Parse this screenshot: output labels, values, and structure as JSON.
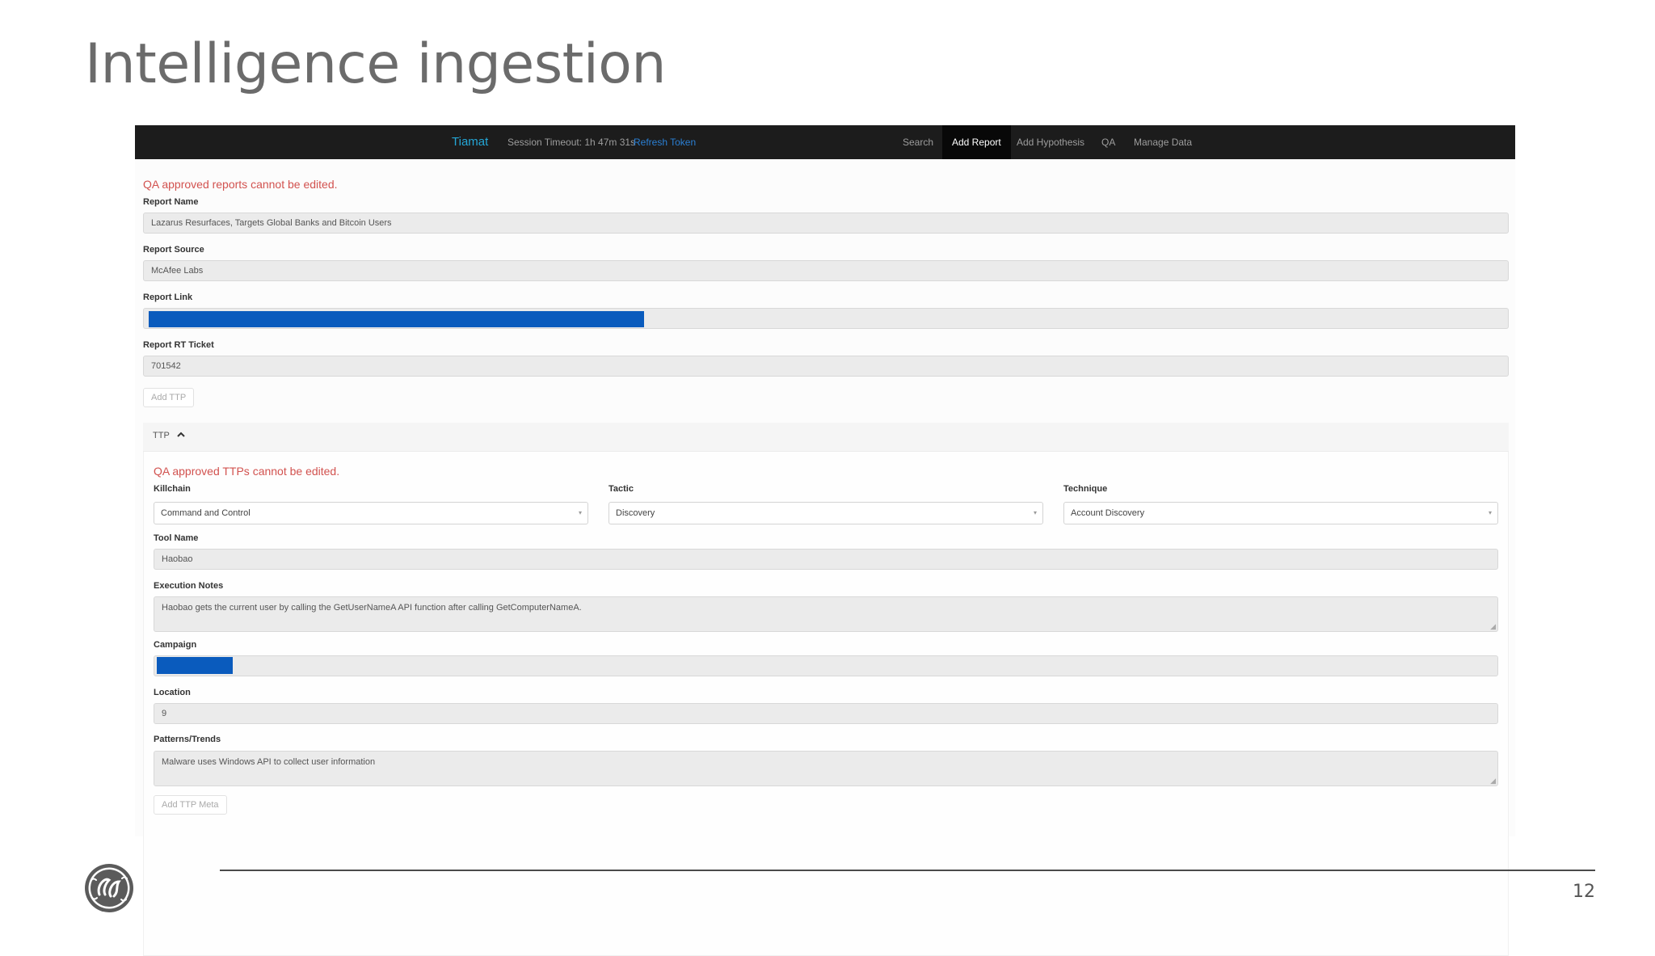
{
  "slide": {
    "title": "Intelligence ingestion",
    "page_number": "12"
  },
  "navbar": {
    "brand": "Tiamat",
    "session_timeout": "Session Timeout: 1h 47m 31s",
    "refresh_token": "Refresh Token",
    "items": [
      {
        "label": "Search"
      },
      {
        "label": "Add Report",
        "active": true
      },
      {
        "label": "Add Hypothesis"
      },
      {
        "label": "QA"
      },
      {
        "label": "Manage Data"
      }
    ]
  },
  "report": {
    "qa_message": "QA approved reports cannot be edited.",
    "name_label": "Report Name",
    "name_value": "Lazarus Resurfaces, Targets Global Banks and Bitcoin Users",
    "source_label": "Report Source",
    "source_value": "McAfee Labs",
    "link_label": "Report Link",
    "link_redacted_fraction": 0.36,
    "ticket_label": "Report RT Ticket",
    "ticket_value": "701542",
    "add_ttp_label": "Add TTP"
  },
  "ttp": {
    "header_label": "TTP",
    "qa_message": "QA approved TTPs cannot be edited.",
    "killchain_label": "Killchain",
    "killchain_value": "Command and Control",
    "tactic_label": "Tactic",
    "tactic_value": "Discovery",
    "technique_label": "Technique",
    "technique_value": "Account Discovery",
    "tool_label": "Tool Name",
    "tool_value": "Haobao",
    "notes_label": "Execution Notes",
    "notes_value": "Haobao gets the current user by calling the GetUserNameA API function after calling GetComputerNameA.",
    "campaign_label": "Campaign",
    "campaign_redacted_fraction": 0.057,
    "location_label": "Location",
    "location_value": "9",
    "patterns_label": "Patterns/Trends",
    "patterns_value": "Malware uses Windows API to collect user information",
    "add_meta_label": "Add TTP Meta"
  },
  "colors": {
    "navbar_bg": "#1c1c1c",
    "brand": "#24a6d6",
    "error_text": "#d2524f",
    "redaction": "#0a5bbd",
    "field_bg": "#ebebeb"
  },
  "icons": {
    "ttp_toggle": "chevron-up-icon",
    "logo": "ge-logo"
  }
}
